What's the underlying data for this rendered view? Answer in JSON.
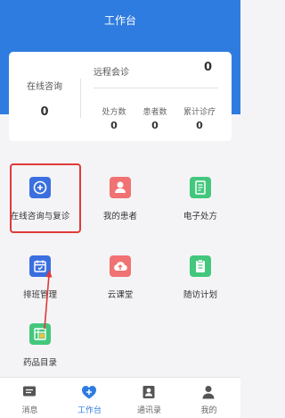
{
  "header": {
    "title": "工作台"
  },
  "stats": {
    "online": {
      "label": "在线咨询",
      "value": "0"
    },
    "remote": {
      "label": "远程会诊",
      "value": "0"
    },
    "prescriptions": {
      "label": "处方数",
      "value": "0"
    },
    "patients": {
      "label": "患者数",
      "value": "0"
    },
    "total_visits": {
      "label": "累计诊疗",
      "value": "0"
    }
  },
  "grid": {
    "items": [
      {
        "label": "在线咨询与复诊",
        "icon": "plus-icon",
        "color": "#3a6fe0"
      },
      {
        "label": "我的患者",
        "icon": "person-icon",
        "color": "#f07272"
      },
      {
        "label": "电子处方",
        "icon": "document-icon",
        "color": "#43c77c"
      },
      {
        "label": "排班管理",
        "icon": "calendar-icon",
        "color": "#3a6fe0"
      },
      {
        "label": "云课堂",
        "icon": "cloud-upload-icon",
        "color": "#f07272"
      },
      {
        "label": "随访计划",
        "icon": "clipboard-icon",
        "color": "#43c77c"
      },
      {
        "label": "药品目录",
        "icon": "drug-list-icon",
        "color": "#43c77c"
      }
    ]
  },
  "tabbar": {
    "items": [
      {
        "label": "消息",
        "icon": "message-icon"
      },
      {
        "label": "工作台",
        "icon": "workbench-icon",
        "active": true
      },
      {
        "label": "通讯录",
        "icon": "contacts-icon"
      },
      {
        "label": "我的",
        "icon": "user-icon"
      }
    ]
  },
  "colors": {
    "primary": "#2f7ce0",
    "annotation_red": "#e03a3a"
  }
}
